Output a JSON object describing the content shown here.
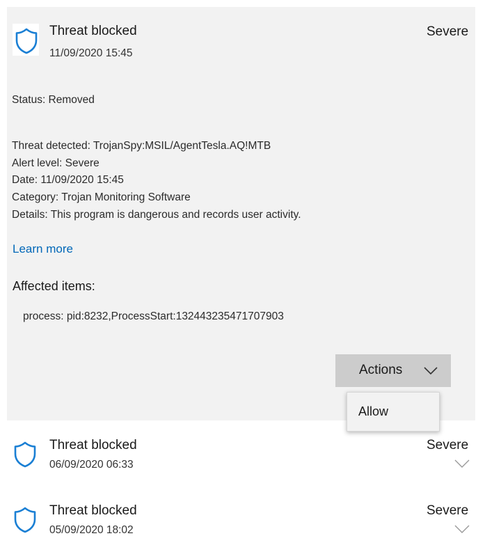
{
  "expanded_item": {
    "title": "Threat blocked",
    "date": "11/09/2020 15:45",
    "severity": "Severe",
    "icon": "shield-icon",
    "status_line": "Status: Removed",
    "details": [
      "Threat detected:  TrojanSpy:MSIL/AgentTesla.AQ!MTB",
      "Alert level: Severe",
      "Date: 11/09/2020 15:45",
      "Category:  Trojan Monitoring Software",
      "Details:  This program is dangerous and records user activity."
    ],
    "learn_more": "Learn more",
    "affected_title": "Affected items:",
    "affected_items": [
      "process: pid:8232,ProcessStart:132443235471707903"
    ],
    "actions_label": "Actions",
    "menu_items": [
      "Allow"
    ]
  },
  "collapsed_items": [
    {
      "title": "Threat blocked",
      "date": "06/09/2020 06:33",
      "severity": "Severe",
      "icon": "shield-icon"
    },
    {
      "title": "Threat blocked",
      "date": "05/09/2020 18:02",
      "severity": "Severe",
      "icon": "shield-icon"
    }
  ],
  "colors": {
    "accent": "#0067b8",
    "shield": "#1a7fd4",
    "panel_bg": "#f2f2f2",
    "button_bg": "#cccccc"
  }
}
